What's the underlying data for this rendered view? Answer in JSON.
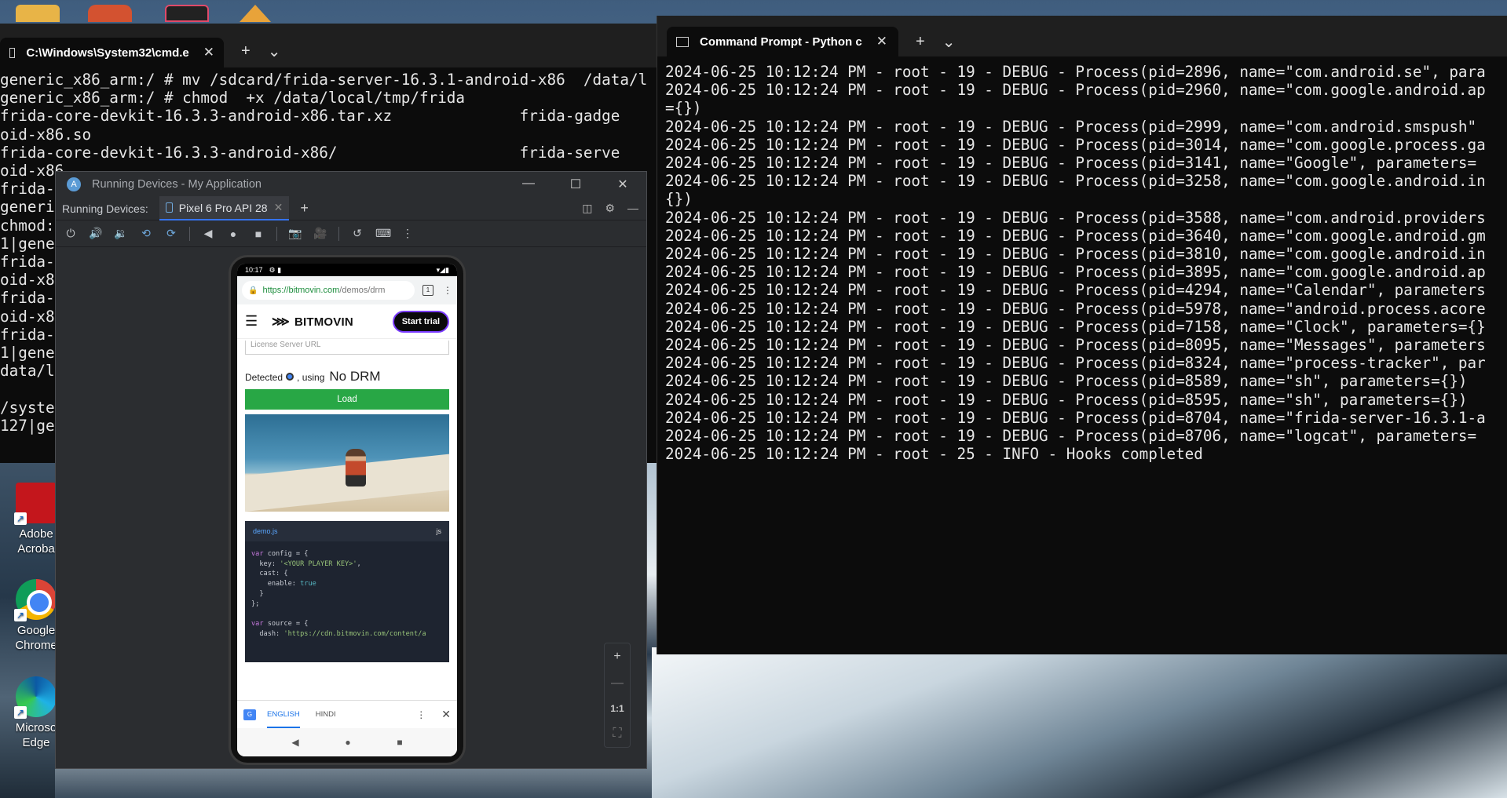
{
  "left_terminal": {
    "tab_title": "C:\\Windows\\System32\\cmd.e",
    "lines": [
      "generic_x86_arm:/ # mv /sdcard/frida-server-16.3.1-android-x86  /data/l",
      "generic_x86_arm:/ # chmod  +x /data/local/tmp/frida",
      "frida-core-devkit-16.3.3-android-x86.tar.xz              frida-gadge",
      "oid-x86.so",
      "frida-core-devkit-16.3.3-android-x86/                    frida-serve",
      "oid-x86",
      "frida-c",
      "generic",
      "chmod: ",
      "1|generi",
      "frida-c                                                             g",
      "oid-x80                                                             g",
      "frida-c                                                             v",
      "oid-x80",
      "frida-c                                                             d",
      "1|generi",
      "data/lo",
      "",
      "/system",
      "127|gen                                                             8"
    ]
  },
  "right_terminal": {
    "tab_title": "Command Prompt - Python  c",
    "lines": [
      "2024-06-25 10:12:24 PM - root - 19 - DEBUG - Process(pid=2896, name=\"com.android.se\", para",
      "2024-06-25 10:12:24 PM - root - 19 - DEBUG - Process(pid=2960, name=\"com.google.android.ap",
      "={})",
      "2024-06-25 10:12:24 PM - root - 19 - DEBUG - Process(pid=2999, name=\"com.android.smspush\"",
      "2024-06-25 10:12:24 PM - root - 19 - DEBUG - Process(pid=3014, name=\"com.google.process.ga",
      "2024-06-25 10:12:24 PM - root - 19 - DEBUG - Process(pid=3141, name=\"Google\", parameters=",
      "2024-06-25 10:12:24 PM - root - 19 - DEBUG - Process(pid=3258, name=\"com.google.android.in",
      "{})",
      "2024-06-25 10:12:24 PM - root - 19 - DEBUG - Process(pid=3588, name=\"com.android.providers",
      "2024-06-25 10:12:24 PM - root - 19 - DEBUG - Process(pid=3640, name=\"com.google.android.gm",
      "2024-06-25 10:12:24 PM - root - 19 - DEBUG - Process(pid=3810, name=\"com.google.android.in",
      "2024-06-25 10:12:24 PM - root - 19 - DEBUG - Process(pid=3895, name=\"com.google.android.ap",
      "2024-06-25 10:12:24 PM - root - 19 - DEBUG - Process(pid=4294, name=\"Calendar\", parameters",
      "2024-06-25 10:12:24 PM - root - 19 - DEBUG - Process(pid=5978, name=\"android.process.acore",
      "2024-06-25 10:12:24 PM - root - 19 - DEBUG - Process(pid=7158, name=\"Clock\", parameters={}",
      "2024-06-25 10:12:24 PM - root - 19 - DEBUG - Process(pid=8095, name=\"Messages\", parameters",
      "2024-06-25 10:12:24 PM - root - 19 - DEBUG - Process(pid=8324, name=\"process-tracker\", par",
      "2024-06-25 10:12:24 PM - root - 19 - DEBUG - Process(pid=8589, name=\"sh\", parameters={})",
      "2024-06-25 10:12:24 PM - root - 19 - DEBUG - Process(pid=8595, name=\"sh\", parameters={})",
      "2024-06-25 10:12:24 PM - root - 19 - DEBUG - Process(pid=8704, name=\"frida-server-16.3.1-a",
      "2024-06-25 10:12:24 PM - root - 19 - DEBUG - Process(pid=8706, name=\"logcat\", parameters=",
      "2024-06-25 10:12:24 PM - root - 25 - INFO - Hooks completed"
    ]
  },
  "studio": {
    "title": "Running Devices - My Application",
    "running_devices_label": "Running Devices:",
    "device_tab": "Pixel 6 Pro API 28",
    "zoom_ratio": "1:1"
  },
  "phone": {
    "time": "10:17",
    "url_host": "https://bitmovin.com",
    "url_path": "/demos/drm",
    "brand": "BITMOVIN",
    "start_trial": "Start trial",
    "license_placeholder": "License Server URL",
    "detected_prefix": "Detected",
    "detected_using": ", using",
    "drm_status": "No DRM",
    "load_label": "Load",
    "code_filename": "demo.js",
    "code_lang": "js",
    "translate_english": "ENGLISH",
    "translate_hindi": "HINDI"
  },
  "desktop_icons": [
    {
      "label": "Adobe Acroba"
    },
    {
      "label": "Google Chrome"
    },
    {
      "label": "Microso Edge"
    }
  ]
}
